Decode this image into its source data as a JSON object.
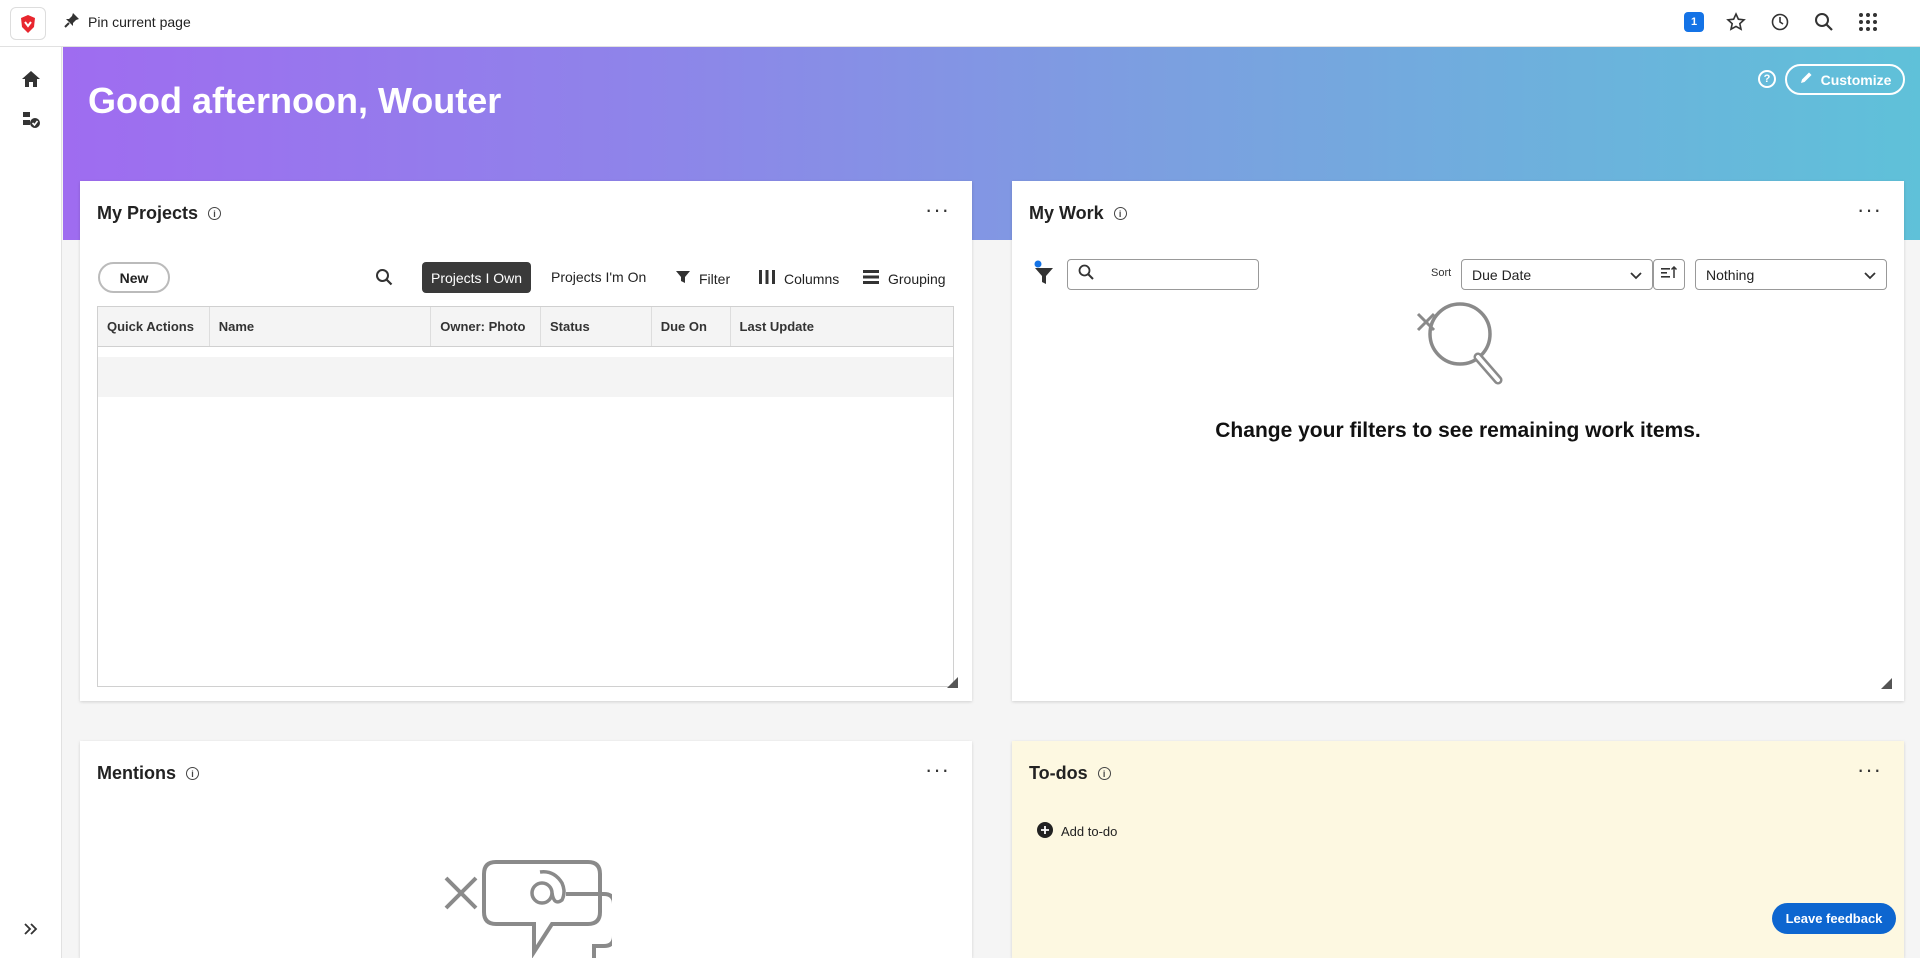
{
  "topbar": {
    "pin_label": "Pin current page",
    "notification_count": "1",
    "icons": [
      "brand-logo-icon",
      "pin-icon",
      "star-icon",
      "history-icon",
      "search-icon",
      "app-grid-icon"
    ]
  },
  "rail": {
    "items": [
      "home-icon",
      "projects-check-icon"
    ],
    "expand_icon": "chevron-double-right-icon"
  },
  "hero": {
    "greeting": "Good afternoon, Wouter",
    "customize_label": "Customize",
    "help_label": "?"
  },
  "my_projects": {
    "title": "My Projects",
    "new_label": "New",
    "tabs": [
      "Projects I Own",
      "Projects I'm On"
    ],
    "filter_label": "Filter",
    "columns_label": "Columns",
    "grouping_label": "Grouping",
    "columns": [
      "Quick Actions",
      "Name",
      "Owner: Photo",
      "Status",
      "Due On",
      "Last Update"
    ]
  },
  "my_work": {
    "title": "My Work",
    "sort_label": "Sort",
    "sort_value": "Due Date",
    "group_value": "Nothing",
    "empty_message": "Change your filters to see remaining work items."
  },
  "mentions": {
    "title": "Mentions"
  },
  "todos": {
    "title": "To-dos",
    "add_label": "Add to-do"
  },
  "feedback_label": "Leave feedback",
  "colors": {
    "accent": "#1473e6",
    "hero_start": "#9f6cf0",
    "hero_end": "#5fc1d9",
    "todo_bg": "#fdf8e1"
  }
}
